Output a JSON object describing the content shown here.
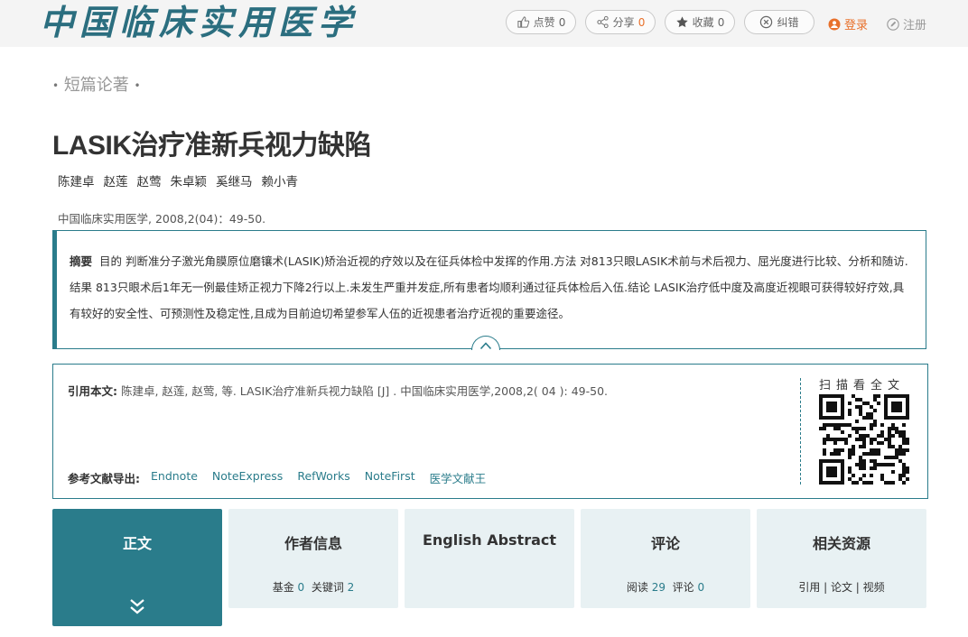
{
  "header": {
    "logo": "中国临床实用医学",
    "like": {
      "label": "点赞",
      "count": "0"
    },
    "share": {
      "label": "分享",
      "count": "0"
    },
    "favorite": {
      "label": "收藏",
      "count": "0"
    },
    "correct": {
      "label": "纠错"
    },
    "login": "登录",
    "register": "注册",
    "accent": "#e8702a"
  },
  "article": {
    "section": "短篇论著",
    "title": "LASIK治疗准新兵视力缺陷",
    "authors": [
      "陈建卓",
      "赵莲",
      "赵莺",
      "朱卓颖",
      "奚继马",
      "赖小青"
    ],
    "journal": "中国临床实用医学, 2008,2(04)：49-50."
  },
  "abstract": {
    "label": "摘要",
    "text": "目的 判断准分子激光角膜原位磨镶术(LASIK)矫治近视的疗效以及在征兵体检中发挥的作用.方法 对813只眼LASIK术前与术后视力、屈光度进行比较、分析和随访.结果 813只眼术后1年无一例最佳矫正视力下降2行以上.未发生严重并发症,所有患者均顺利通过征兵体检后入伍.结论 LASIK治疗低中度及高度近视眼可获得较好疗效,具有较好的安全性、可预测性及稳定性,且成为目前迫切希望参军人伍的近视患者治疗近视的重要途径。"
  },
  "citation": {
    "label": "引用本文:",
    "text": "陈建卓, 赵莲, 赵莺, 等.  LASIK治疗准新兵视力缺陷 [J] . 中国临床实用医学,2008,2( 04 ): 49-50.",
    "export_label": "参考文献导出:",
    "export_formats": [
      "Endnote",
      "NoteExpress",
      "RefWorks",
      "NoteFirst",
      "医学文献王"
    ],
    "qr_label": "扫描看全文"
  },
  "tabs": [
    {
      "label": "正文",
      "active": true
    },
    {
      "label": "作者信息",
      "sub": [
        {
          "k": "基金",
          "v": "0"
        },
        {
          "k": "关键词",
          "v": "2"
        }
      ]
    },
    {
      "label": "English Abstract"
    },
    {
      "label": "评论",
      "sub": [
        {
          "k": "阅读",
          "v": "29"
        },
        {
          "k": "评论",
          "v": "0"
        }
      ]
    },
    {
      "label": "相关资源",
      "sub_text": "引用 | 论文 | 视频"
    }
  ],
  "colors": {
    "primary": "#2a7c8b",
    "tab_bg": "#e8f1f3"
  }
}
